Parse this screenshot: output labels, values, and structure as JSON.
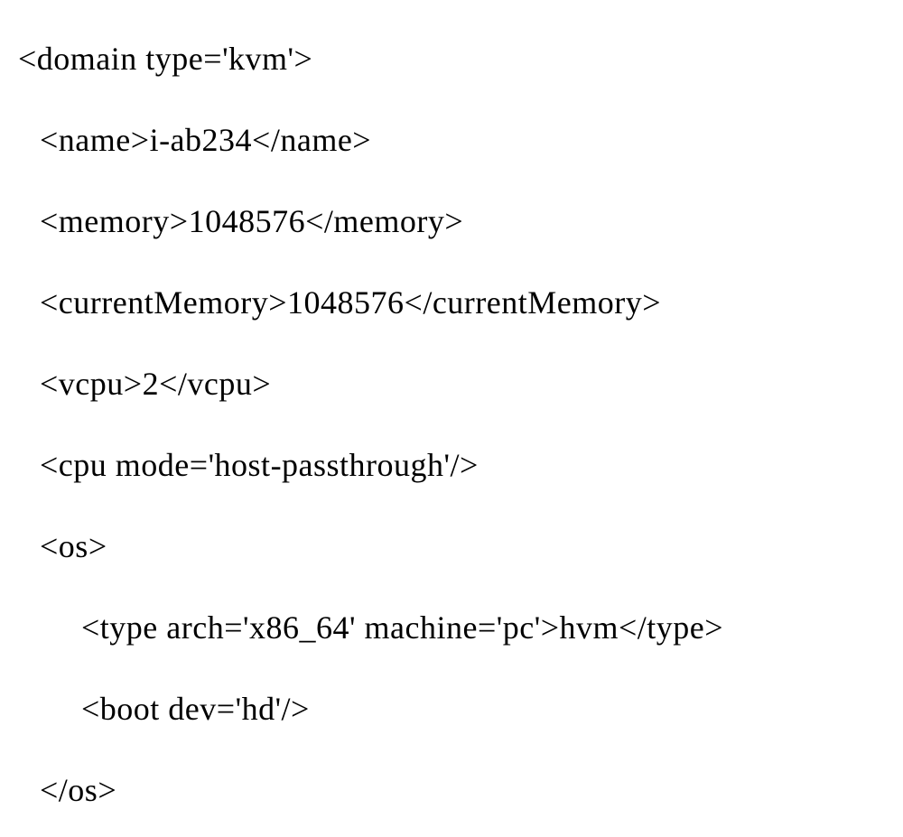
{
  "lines": {
    "l1": "<domain type='kvm'>",
    "l2": "<name>i-ab234</name>",
    "l3": "<memory>1048576</memory>",
    "l4": "<currentMemory>1048576</currentMemory>",
    "l5": "<vcpu>2</vcpu>",
    "l6": "<cpu mode='host-passthrough'/>",
    "l7": "<os>",
    "l8": "<type arch='x86_64' machine='pc'>hvm</type>",
    "l9": "<boot dev='hd'/>",
    "l10": "</os>"
  }
}
